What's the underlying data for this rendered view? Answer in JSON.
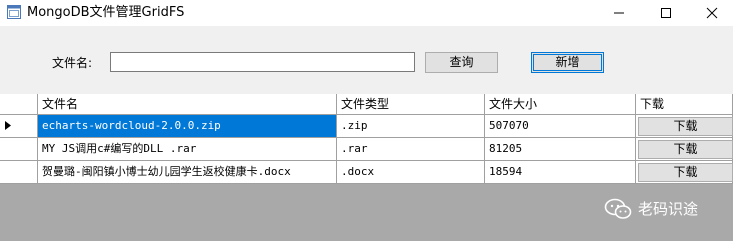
{
  "window": {
    "title": "MongoDB文件管理GridFS",
    "controls": {
      "minimize_icon": "minimize-icon",
      "maximize_icon": "maximize-icon",
      "close_icon": "close-icon"
    }
  },
  "form": {
    "filename_label": "文件名:",
    "filename_value": "",
    "query_label": "查询",
    "add_label": "新增"
  },
  "grid": {
    "columns": [
      "文件名",
      "文件类型",
      "文件大小",
      "下载"
    ],
    "rows": [
      {
        "name": "echarts-wordcloud-2.0.0.zip",
        "type": ".zip",
        "size": "507070",
        "download": "下载",
        "selected": true
      },
      {
        "name": "MY JS调用c#编写的DLL  .rar",
        "type": ".rar",
        "size": "81205",
        "download": "下载",
        "selected": false
      },
      {
        "name": "贺曼璐-闽阳镇小博士幼儿园学生返校健康卡.docx",
        "type": ".docx",
        "size": "18594",
        "download": "下载",
        "selected": false
      }
    ]
  },
  "watermark": {
    "text": "老码识途",
    "icon": "wechat-icon"
  },
  "colors": {
    "selection": "#0078d7",
    "empty_area": "#a9a9a9",
    "button_face": "#e1e1e1"
  }
}
